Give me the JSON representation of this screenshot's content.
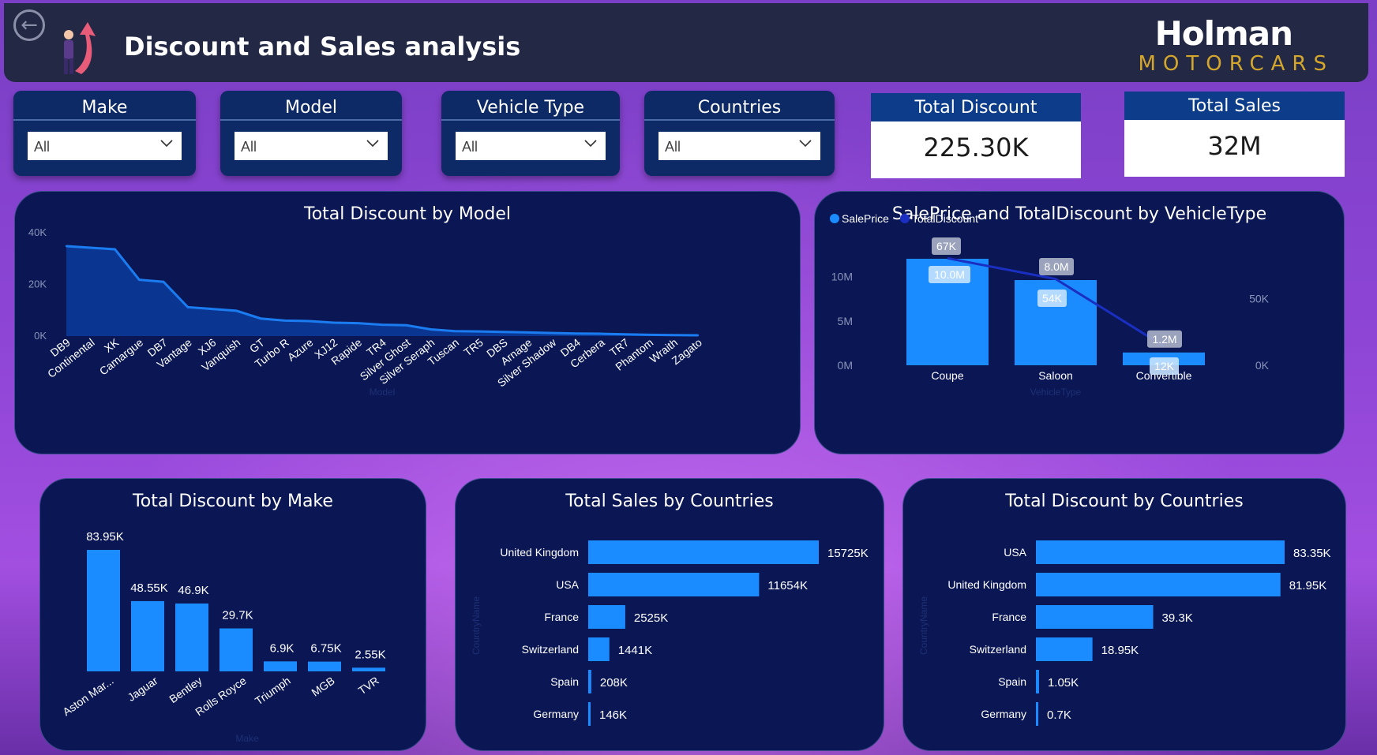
{
  "header": {
    "back_icon": "back-arrow-icon",
    "title": "Discount and Sales analysis",
    "brand_name": "Holman",
    "brand_sub": "MOTORCARS"
  },
  "slicers": [
    {
      "label": "Make",
      "value": "All"
    },
    {
      "label": "Model",
      "value": "All"
    },
    {
      "label": "Vehicle Type",
      "value": "All"
    },
    {
      "label": "Countries",
      "value": "All"
    }
  ],
  "kpis": {
    "total_discount": {
      "label": "Total Discount",
      "value": "225.30K"
    },
    "total_sales": {
      "label": "Total Sales",
      "value": "32M"
    }
  },
  "colors": {
    "bar": "#1a8cff",
    "area_fill": "#0a3c9e",
    "line": "#1a7cf0",
    "line_dark": "#1a2fc2",
    "panel": "#0b1754"
  },
  "chart_data": [
    {
      "id": "discount_by_model",
      "type": "area",
      "title": "Total Discount by Model",
      "xlabel": "Model",
      "ylabel": "",
      "ylim": [
        0,
        40000
      ],
      "yticks": [
        "0K",
        "20K",
        "40K"
      ],
      "categories": [
        "DB9",
        "Continental",
        "XK",
        "Camargue",
        "DB7",
        "Vantage",
        "XJ6",
        "Vanquish",
        "GT",
        "Turbo R",
        "Azure",
        "XJ12",
        "Rapide",
        "TR4",
        "Silver Ghost",
        "Silver Seraph",
        "Tuscan",
        "TR5",
        "DBS",
        "Arnage",
        "Silver Shadow",
        "DB4",
        "Cerbera",
        "TR7",
        "Phantom",
        "Wraith",
        "Zagato"
      ],
      "values": [
        34800,
        34200,
        33600,
        21800,
        21000,
        11200,
        10500,
        9800,
        6800,
        6000,
        5800,
        5200,
        5000,
        4400,
        4200,
        2600,
        1900,
        1800,
        1600,
        1400,
        1200,
        1000,
        900,
        700,
        500,
        400,
        300
      ]
    },
    {
      "id": "price_discount_by_type",
      "type": "bar",
      "title": "SalePrice and TotalDiscount by VehicleType",
      "xlabel": "VehicleType",
      "legend": [
        "SalePrice",
        "TotalDiscount"
      ],
      "categories": [
        "Coupe",
        "Saloon",
        "Convertible"
      ],
      "series": [
        {
          "name": "SalePrice",
          "values": [
            10000000,
            8000000,
            1200000
          ],
          "labels": [
            "10.0M",
            "8.0M",
            "1.2M"
          ],
          "axis": "left"
        },
        {
          "name": "TotalDiscount",
          "values": [
            67000,
            54000,
            12000
          ],
          "labels": [
            "67K",
            "54K",
            "12K"
          ],
          "axis": "right"
        }
      ],
      "ylim": [
        0,
        12000000
      ],
      "yticks": [
        "0M",
        "5M",
        "10M"
      ],
      "y2lim": [
        0,
        80000
      ],
      "y2ticks": [
        "0K",
        "50K"
      ]
    },
    {
      "id": "discount_by_make",
      "type": "bar",
      "title": "Total Discount by Make",
      "xlabel": "Make",
      "categories": [
        "Aston Mar...",
        "Jaguar",
        "Bentley",
        "Rolls Royce",
        "Triumph",
        "MGB",
        "TVR"
      ],
      "values": [
        83950,
        48550,
        46900,
        29700,
        6900,
        6750,
        2550
      ],
      "labels": [
        "83.95K",
        "48.55K",
        "46.9K",
        "29.7K",
        "6.9K",
        "6.75K",
        "2.55K"
      ]
    },
    {
      "id": "sales_by_countries",
      "type": "bar",
      "orientation": "horizontal",
      "title": "Total Sales by Countries",
      "ylabel": "CountryName",
      "categories": [
        "United Kingdom",
        "USA",
        "France",
        "Switzerland",
        "Spain",
        "Germany"
      ],
      "values": [
        15725,
        11654,
        2525,
        1441,
        208,
        146
      ],
      "labels": [
        "15725K",
        "11654K",
        "2525K",
        "1441K",
        "208K",
        "146K"
      ]
    },
    {
      "id": "discount_by_countries",
      "type": "bar",
      "orientation": "horizontal",
      "title": "Total Discount by Countries",
      "ylabel": "CountryName",
      "categories": [
        "USA",
        "United Kingdom",
        "France",
        "Switzerland",
        "Spain",
        "Germany"
      ],
      "values": [
        83.35,
        81.95,
        39.3,
        18.95,
        1.05,
        0.7
      ],
      "labels": [
        "83.35K",
        "81.95K",
        "39.3K",
        "18.95K",
        "1.05K",
        "0.7K"
      ]
    }
  ]
}
